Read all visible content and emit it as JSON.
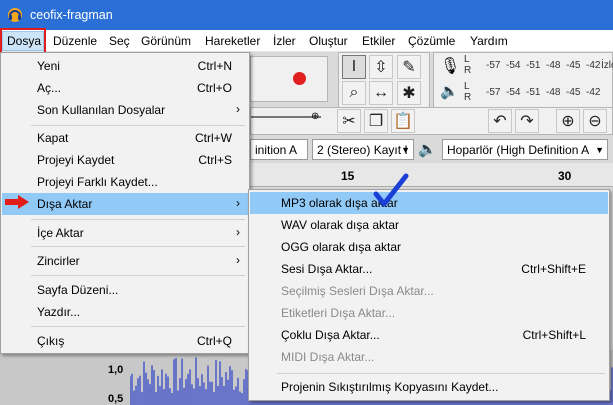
{
  "window": {
    "title": "ceofix-fragman"
  },
  "menubar": {
    "items": [
      "Dosya",
      "Düzenle",
      "Seç",
      "Görünüm",
      "Hareketler",
      "İzler",
      "Oluştur",
      "Etkiler",
      "Çözümle",
      "Yardım"
    ]
  },
  "toolbar": {
    "meter_lr": [
      "L",
      "R",
      "L",
      "R"
    ],
    "meter_ticks": [
      "-57",
      "-54",
      "-51",
      "-48",
      "-45",
      "-42"
    ],
    "meter_extra": "İzle",
    "host_combo": "inition A",
    "channels_combo": "2 (Stereo) Kayıt I",
    "output_combo": "Hoparlör (High Definition A",
    "ruler_ticks": [
      "15",
      "30"
    ]
  },
  "track": {
    "scale_top": "1,0",
    "scale_mid": "0,5"
  },
  "file_menu": {
    "items": [
      {
        "label": "Yeni",
        "shortcut": "Ctrl+N"
      },
      {
        "label": "Aç...",
        "shortcut": "Ctrl+O"
      },
      {
        "label": "Son Kullanılan Dosyalar",
        "shortcut": "",
        "submenu": true
      },
      {
        "label": "Kapat",
        "shortcut": "Ctrl+W"
      },
      {
        "label": "Projeyi Kaydet",
        "shortcut": "Ctrl+S"
      },
      {
        "label": "Projeyi Farklı Kaydet...",
        "shortcut": ""
      },
      {
        "label": "Dışa Aktar",
        "shortcut": "",
        "submenu": true,
        "highlighted": true
      },
      {
        "label": "İçe Aktar",
        "shortcut": "",
        "submenu": true
      },
      {
        "label": "Zincirler",
        "shortcut": "",
        "submenu": true
      },
      {
        "label": "Sayfa Düzeni...",
        "shortcut": ""
      },
      {
        "label": "Yazdır...",
        "shortcut": ""
      },
      {
        "label": "Çıkış",
        "shortcut": "Ctrl+Q"
      }
    ]
  },
  "export_submenu": {
    "items": [
      {
        "label": "MP3 olarak dışa aktar",
        "shortcut": "",
        "highlighted": true
      },
      {
        "label": "WAV olarak dışa aktar",
        "shortcut": ""
      },
      {
        "label": "OGG olarak dışa aktar",
        "shortcut": ""
      },
      {
        "label": "Sesi Dışa Aktar...",
        "shortcut": "Ctrl+Shift+E"
      },
      {
        "label": "Seçilmiş Sesleri Dışa Aktar...",
        "shortcut": "",
        "disabled": true
      },
      {
        "label": "Etiketleri Dışa Aktar...",
        "shortcut": "",
        "disabled": true
      },
      {
        "label": "Çoklu Dışa Aktar...",
        "shortcut": "Ctrl+Shift+L"
      },
      {
        "label": "MIDI Dışa Aktar...",
        "shortcut": "",
        "disabled": true
      },
      {
        "label": "Projenin Sıkıştırılmış Kopyasını Kaydet...",
        "shortcut": ""
      }
    ]
  },
  "colors": {
    "titlebar": "#2a6fd6",
    "highlight": "#91c9f7",
    "annotation_red": "#e21b1b",
    "annotation_check": "#1b3fd6",
    "waveform": "#3f51c8"
  }
}
